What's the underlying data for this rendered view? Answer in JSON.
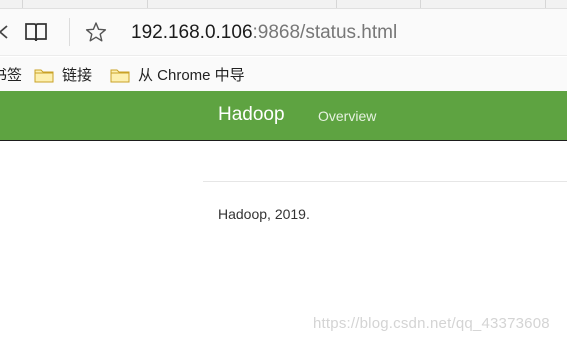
{
  "browser": {
    "address": {
      "host": "192.168.0.106",
      "rest": ":9868/status.html"
    },
    "bookmarks": [
      {
        "label": "书签"
      },
      {
        "label": "链接"
      },
      {
        "label": "从 Chrome 中导"
      }
    ]
  },
  "page": {
    "navbar": {
      "brand": "Hadoop",
      "links": [
        "Overview"
      ],
      "color": "#5ea341"
    },
    "footer": "Hadoop, 2019."
  },
  "watermark": "https://blog.csdn.net/qq_43373608",
  "icons": [
    "back-icon",
    "reading-view-icon",
    "favorite-star-icon",
    "folder-icon"
  ]
}
